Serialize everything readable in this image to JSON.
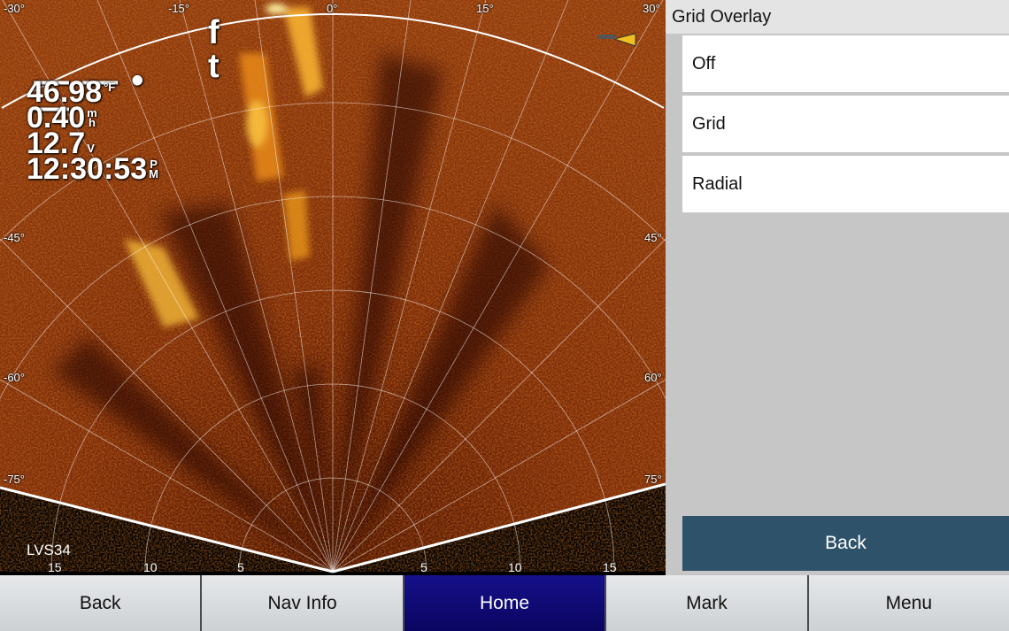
{
  "sonar": {
    "mode": "forward-live-sonar",
    "grid_overlay": "Radial",
    "angle_labels": {
      "top_m30": "-30°",
      "top_m15": "-15°",
      "top_0": "0°",
      "top_15": "15°",
      "top_30": "30°",
      "left_m45": "-45°",
      "left_m60": "-60°",
      "left_m75": "-75°",
      "right_45": "45°",
      "right_60": "60°",
      "right_75": "75°"
    },
    "range_labels": [
      "15",
      "10",
      "5",
      "5",
      "10",
      "15"
    ],
    "transducer": "LVS34",
    "depth_display": "— — • —",
    "depth_unit_top": "f",
    "depth_unit_bottom": "t",
    "readouts": {
      "water_temp": "46.98",
      "water_temp_unit": "°F",
      "speed": "0.40",
      "speed_unit_top": "m",
      "speed_unit_bottom": "h",
      "voltage": "12.7",
      "voltage_unit": "V",
      "time": "12:30:53",
      "time_unit_top": "P",
      "time_unit_bottom": "M"
    },
    "colors": {
      "background": "#000000",
      "sonar_base": "#7a2a08",
      "return_highlight": "#ffe04a",
      "boat_icon": "#f0c020"
    }
  },
  "panel": {
    "title": "Grid Overlay",
    "options": [
      "Off",
      "Grid",
      "Radial"
    ],
    "selected": "Radial",
    "back_label": "Back",
    "back_color": "#2f526b"
  },
  "bottom_bar": {
    "buttons": [
      "Back",
      "Nav Info",
      "Home",
      "Mark",
      "Menu"
    ],
    "active": "Home",
    "active_color": "#0f0a78"
  }
}
